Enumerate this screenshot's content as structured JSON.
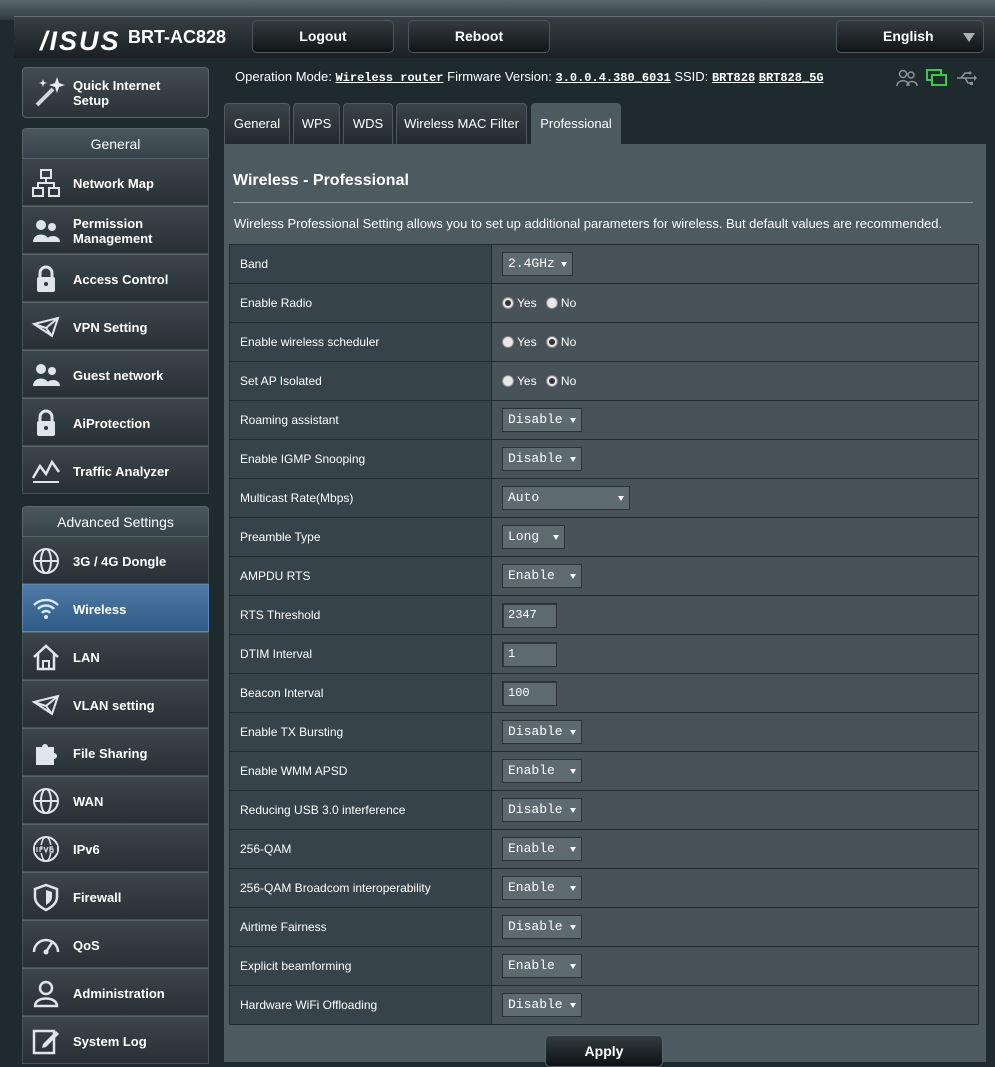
{
  "header": {
    "logo": "/ISUS",
    "model": "BRT-AC828",
    "logout_label": "Logout",
    "reboot_label": "Reboot",
    "language": "English"
  },
  "sidebar": {
    "quick_setup": "Quick Internet Setup",
    "general_title": "General",
    "general_items": [
      {
        "label": "Network Map",
        "icon": "network-map-icon"
      },
      {
        "label": "Permission Management",
        "icon": "users-icon"
      },
      {
        "label": "Access Control",
        "icon": "lock-icon"
      },
      {
        "label": "VPN Setting",
        "icon": "vpn-icon"
      },
      {
        "label": "Guest network",
        "icon": "guest-users-icon"
      },
      {
        "label": "AiProtection",
        "icon": "lock-shield-icon"
      },
      {
        "label": "Traffic Analyzer",
        "icon": "traffic-chart-icon"
      }
    ],
    "advanced_title": "Advanced Settings",
    "advanced_items": [
      {
        "label": "3G / 4G Dongle",
        "icon": "globe-icon"
      },
      {
        "label": "Wireless",
        "icon": "wifi-icon"
      },
      {
        "label": "LAN",
        "icon": "home-icon"
      },
      {
        "label": "VLAN setting",
        "icon": "vpn-icon"
      },
      {
        "label": "File Sharing",
        "icon": "puzzle-icon"
      },
      {
        "label": "WAN",
        "icon": "globe-icon"
      },
      {
        "label": "IPv6",
        "icon": "ipv6-globe-icon"
      },
      {
        "label": "Firewall",
        "icon": "shield-icon"
      },
      {
        "label": "QoS",
        "icon": "speedometer-icon"
      },
      {
        "label": "Administration",
        "icon": "admin-user-icon"
      },
      {
        "label": "System Log",
        "icon": "log-edit-icon"
      }
    ]
  },
  "status": {
    "mode_label": "Operation Mode:",
    "mode_value": "Wireless router",
    "fw_label": "Firmware Version:",
    "fw_value": "3.0.0.4.380_6031",
    "ssid_label": "SSID:",
    "ssid_1": "BRT828",
    "ssid_2": "BRT828_5G"
  },
  "tabs": [
    "General",
    "WPS",
    "WDS",
    "Wireless MAC Filter",
    "Professional"
  ],
  "page": {
    "title": "Wireless - Professional",
    "description": "Wireless Professional Setting allows you to set up additional parameters for wireless. But default values are recommended."
  },
  "radio_labels": {
    "yes": "Yes",
    "no": "No"
  },
  "fields": {
    "band": {
      "label": "Band",
      "value": "2.4GHz"
    },
    "enable_radio": {
      "label": "Enable Radio"
    },
    "scheduler": {
      "label": "Enable wireless scheduler"
    },
    "ap_isolated": {
      "label": "Set AP Isolated"
    },
    "roaming": {
      "label": "Roaming assistant",
      "value": "Disable"
    },
    "igmp": {
      "label": "Enable IGMP Snooping",
      "value": "Disable"
    },
    "multicast": {
      "label": "Multicast Rate(Mbps)",
      "value": "Auto"
    },
    "preamble": {
      "label": "Preamble Type",
      "value": "Long"
    },
    "ampdu_rts": {
      "label": "AMPDU RTS",
      "value": "Enable"
    },
    "rts_threshold": {
      "label": "RTS Threshold",
      "value": "2347"
    },
    "dtim": {
      "label": "DTIM Interval",
      "value": "1"
    },
    "beacon": {
      "label": "Beacon Interval",
      "value": "100"
    },
    "tx_bursting": {
      "label": "Enable TX Bursting",
      "value": "Disable"
    },
    "wmm_apsd": {
      "label": "Enable WMM APSD",
      "value": "Enable"
    },
    "usb3": {
      "label": "Reducing USB 3.0 interference",
      "value": "Disable"
    },
    "qam256": {
      "label": "256-QAM",
      "value": "Enable"
    },
    "qam256_bcm": {
      "label": "256-QAM Broadcom interoperability",
      "value": "Enable"
    },
    "airtime": {
      "label": "Airtime Fairness",
      "value": "Disable"
    },
    "beamforming": {
      "label": "Explicit beamforming",
      "value": "Enable"
    },
    "hw_offload": {
      "label": "Hardware WiFi Offloading",
      "value": "Disable"
    }
  },
  "apply_label": "Apply"
}
